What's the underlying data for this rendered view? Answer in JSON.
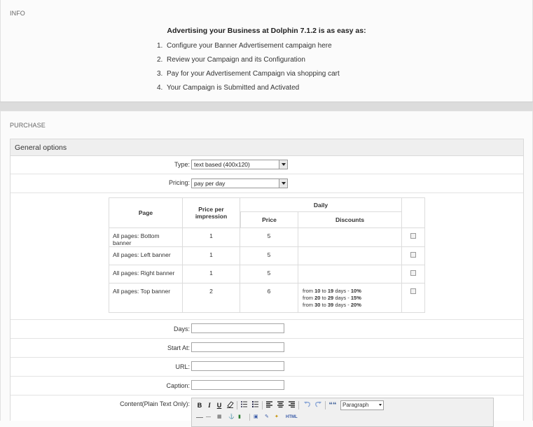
{
  "info": {
    "label": "INFO",
    "title": "Advertising your Business at Dolphin 7.1.2 is as easy as:",
    "steps": [
      {
        "num": "1.",
        "text": "Configure your Banner Advertisement campaign here"
      },
      {
        "num": "2.",
        "text": "Review your Campaign and its Configuration"
      },
      {
        "num": "3.",
        "text": "Pay for your Advertisement Campaign via shopping cart"
      },
      {
        "num": "4.",
        "text": "Your Campaign is Submitted and Activated"
      }
    ]
  },
  "purchase": {
    "label": "PURCHASE",
    "section_title": "General options",
    "type": {
      "label": "Type:",
      "value": "text based (400x120)"
    },
    "pricing": {
      "label": "Pricing:",
      "value": "pay per day"
    },
    "table": {
      "headers": {
        "page": "Page",
        "price_per_impression": "Price per impression",
        "daily": "Daily",
        "price": "Price",
        "discounts": "Discounts"
      },
      "rows": [
        {
          "page": "All pages: Bottom banner",
          "ppi": "1",
          "price": "5",
          "discounts": []
        },
        {
          "page": "All pages: Left banner",
          "ppi": "1",
          "price": "5",
          "discounts": []
        },
        {
          "page": "All pages: Right banner",
          "ppi": "1",
          "price": "5",
          "discounts": []
        },
        {
          "page": "All pages: Top banner",
          "ppi": "2",
          "price": "6",
          "discounts": [
            {
              "pre": "from",
              "a": "10",
              "mid": "to",
              "b": "19",
              "post": "days -",
              "pct": "10%"
            },
            {
              "pre": "from",
              "a": "20",
              "mid": "to",
              "b": "29",
              "post": "days -",
              "pct": "15%"
            },
            {
              "pre": "from",
              "a": "30",
              "mid": "to",
              "b": "39",
              "post": "days -",
              "pct": "20%"
            }
          ]
        }
      ]
    },
    "fields": {
      "days": {
        "label": "Days:",
        "value": ""
      },
      "start_at": {
        "label": "Start At:",
        "value": ""
      },
      "url": {
        "label": "URL:",
        "value": ""
      },
      "caption": {
        "label": "Caption:",
        "value": ""
      },
      "content": {
        "label": "Content(Plain Text Only):"
      }
    },
    "editor": {
      "format_value": "Paragraph",
      "bold": "B",
      "italic": "I",
      "underline": "U",
      "quote": "““",
      "html": "HTML"
    }
  }
}
